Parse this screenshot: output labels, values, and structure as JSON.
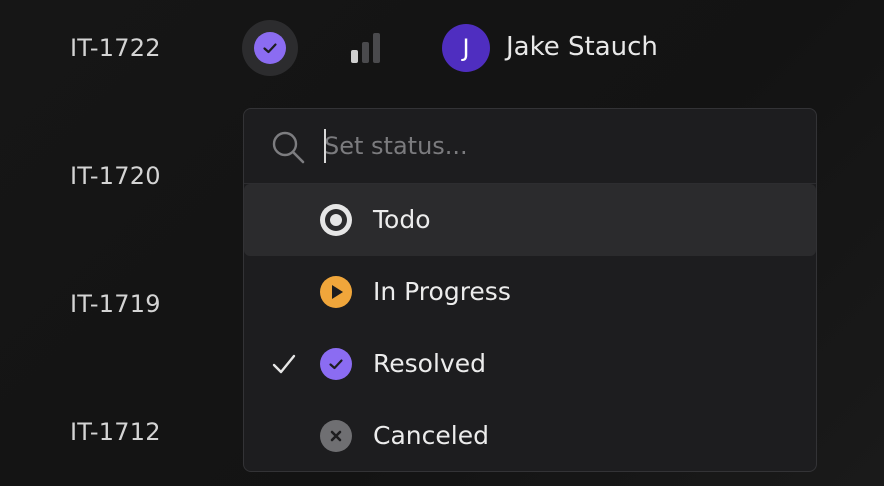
{
  "issues": [
    {
      "id": "IT-1722"
    },
    {
      "id": "IT-1720"
    },
    {
      "id": "IT-1719"
    },
    {
      "id": "IT-1712"
    }
  ],
  "row1": {
    "status_icon": "resolved-check-icon",
    "priority_icon": "priority-bars-icon",
    "assignee": {
      "initial": "J",
      "name": "Jake Stauch",
      "avatar_color": "#4f2ec0"
    }
  },
  "status_menu": {
    "search_placeholder": "Set status...",
    "selected": "Resolved",
    "highlighted": "Todo",
    "options": [
      {
        "label": "Todo",
        "icon": "todo-circle-icon",
        "color": "#e6e6e6"
      },
      {
        "label": "In Progress",
        "icon": "in-progress-play-icon",
        "color": "#f0a63b"
      },
      {
        "label": "Resolved",
        "icon": "resolved-check-icon",
        "color": "#8b6cf2"
      },
      {
        "label": "Canceled",
        "icon": "canceled-x-icon",
        "color": "#6f6f72"
      }
    ]
  },
  "colors": {
    "background": "#141414",
    "menu_background": "#1d1d1f",
    "highlight": "#2b2b2d",
    "accent_purple": "#8b6cf2"
  }
}
